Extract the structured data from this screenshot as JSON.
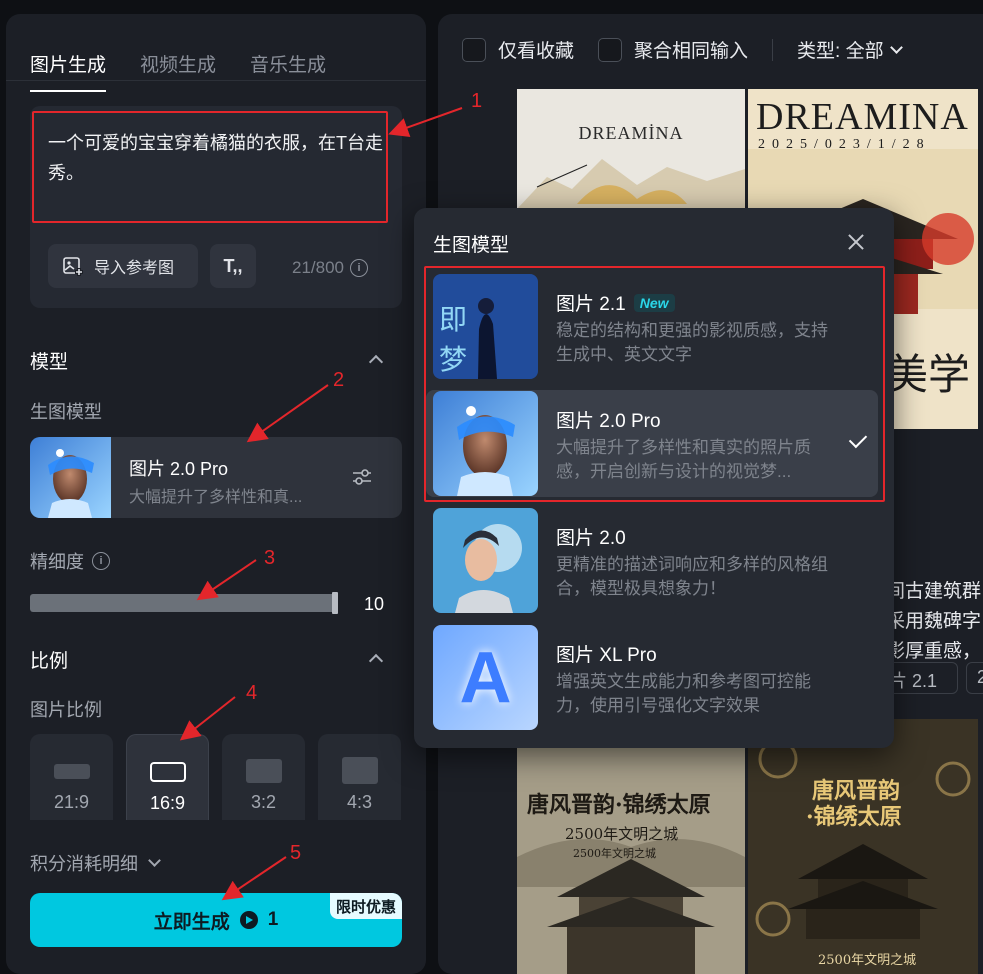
{
  "tabs": [
    {
      "label": "图片生成",
      "active": true
    },
    {
      "label": "视频生成",
      "active": false
    },
    {
      "label": "音乐生成",
      "active": false
    }
  ],
  "prompt": {
    "text": "一个可爱的宝宝穿着橘猫的衣服，在T台走秀。",
    "counter": "21/800",
    "import_ref_label": "导入参考图",
    "text_tool_label": "T,,"
  },
  "model_section": {
    "title": "模型",
    "sub_label": "生图模型",
    "selected_name": "图片 2.0 Pro",
    "selected_desc": "大幅提升了多样性和真..."
  },
  "precision": {
    "label": "精细度",
    "value": "10",
    "level": 1.0
  },
  "ratio_section": {
    "title": "比例",
    "sub_label": "图片比例",
    "options": [
      {
        "label": "21:9",
        "selected": false
      },
      {
        "label": "16:9",
        "selected": true
      },
      {
        "label": "3:2",
        "selected": false
      },
      {
        "label": "4:3",
        "selected": false
      }
    ]
  },
  "cost_detail": "积分消耗明细",
  "generate": {
    "label": "立即生成",
    "credits": "1",
    "promo": "限时优惠"
  },
  "annotations": [
    "1",
    "2",
    "3",
    "4",
    "5"
  ],
  "filters": {
    "favorites_only": "仅看收藏",
    "merge_same": "聚合相同输入",
    "type_label": "类型: 全部"
  },
  "gallery": {
    "tile1_text": "DREAMİNA",
    "tile2_title": "DREAMINA",
    "tile2_date": "2025/023/1/28",
    "tile2_big": "美学",
    "snippet_lines": [
      "间古建筑群",
      "采用魏碑字",
      "影厚重感，"
    ],
    "chip1": "片 2.1",
    "chip2": "2",
    "tile3_title": "唐风晋韵·锦绣太原",
    "tile3_sub": "2500年文明之城",
    "tile3_sub2": "2500年文明之城",
    "tile4_title1": "唐风晋韵",
    "tile4_title2": "·锦绣太原",
    "tile4_sub": "2500年文明之城"
  },
  "popup": {
    "title": "生图模型",
    "options": [
      {
        "name": "图片 2.1",
        "badge": "New",
        "desc": "稳定的结构和更强的影视质感，支持生成中、英文文字",
        "thumb_text": "即 梦",
        "selected": false
      },
      {
        "name": "图片 2.0 Pro",
        "badge": "",
        "desc": "大幅提升了多样性和真实的照片质感，开启创新与设计的视觉梦...",
        "selected": true
      },
      {
        "name": "图片 2.0",
        "badge": "",
        "desc": "更精准的描述词响应和多样的风格组合，模型极具想象力！",
        "selected": false
      },
      {
        "name": "图片 XL Pro",
        "badge": "",
        "desc": "增强英文生成能力和参考图可控能力，使用引号强化文字效果",
        "thumb_text": "A",
        "selected": false
      }
    ]
  },
  "colors": {
    "accent": "#00c8e0",
    "highlight": "#e3262b",
    "panel": "#1c1f26",
    "background": "#0e1014"
  }
}
